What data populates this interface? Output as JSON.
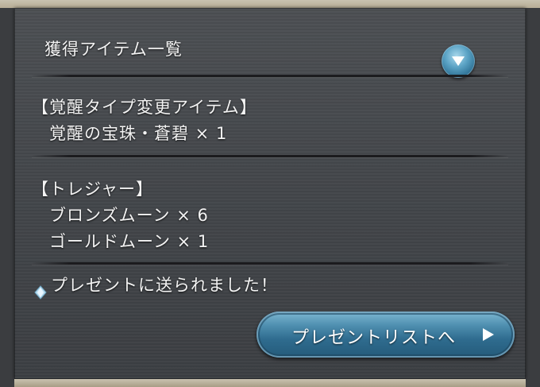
{
  "dialog": {
    "header_title": "獲得アイテム一覧",
    "sections": [
      {
        "heading": "【覚醒タイプ変更アイテム】",
        "items": [
          "覚醒の宝珠・蒼碧 × 1"
        ]
      },
      {
        "heading": "【トレジャー】",
        "items": [
          "ブロンズムーン × 6",
          "ゴールドムーン × 1"
        ]
      }
    ],
    "notice": "プレゼントに送られました！",
    "present_list_button_label": "プレゼントリストへ"
  },
  "icons": {
    "toggle": "chevron-down-icon",
    "notice": "diamond-icon",
    "button_arrow": "arrow-right-icon"
  },
  "colors": {
    "panel": "#45484c",
    "button_blue": "#3a7ca0",
    "text": "#f3f3f3"
  }
}
